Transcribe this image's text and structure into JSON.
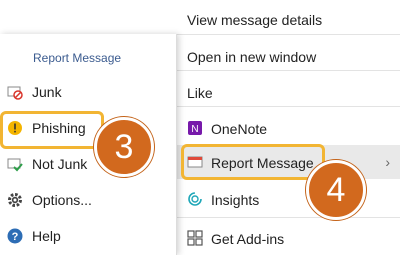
{
  "right_menu": {
    "items": [
      {
        "label": "View message details"
      },
      {
        "label": "Open in new window"
      },
      {
        "label": "Like"
      },
      {
        "label": "OneNote",
        "icon": "onenote-icon"
      },
      {
        "label": "Report Message",
        "icon": "report-message-icon",
        "submenu": true
      },
      {
        "label": "Insights",
        "icon": "insights-icon"
      },
      {
        "label": "Get Add-ins",
        "icon": "addins-icon"
      }
    ]
  },
  "left_menu": {
    "title": "Report Message",
    "items": [
      {
        "label": "Junk",
        "icon": "junk-icon"
      },
      {
        "label": "Phishing",
        "icon": "phishing-warning-icon"
      },
      {
        "label": "Not Junk",
        "icon": "not-junk-icon"
      },
      {
        "label": "Options...",
        "icon": "gear-icon"
      },
      {
        "label": "Help",
        "icon": "help-icon"
      }
    ]
  },
  "callouts": {
    "step3": "3",
    "step4": "4"
  },
  "colors": {
    "callout_fill": "#d2691e",
    "highlight_border": "#f2b533",
    "submenu_title": "#3b5b8f"
  }
}
